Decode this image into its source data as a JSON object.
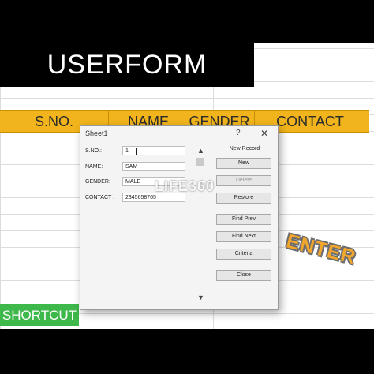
{
  "banner": {
    "title": "USERFORM"
  },
  "sheet": {
    "headers": [
      "S.NO.",
      "NAME",
      "GENDER",
      "CONTACT"
    ],
    "header_color": "#f1b41c",
    "shortcut_label": "SHORTCUT",
    "shortcut_color": "#3eb84a"
  },
  "dialog": {
    "title": "Sheet1",
    "help": "?",
    "close": "✕",
    "fields": [
      {
        "label": "S.NO.:",
        "value": "1"
      },
      {
        "label": "NAME:",
        "value": "SAM"
      },
      {
        "label": "GENDER:",
        "value": "MALE"
      },
      {
        "label": "CONTACT :",
        "value": "2345658765"
      }
    ],
    "record_label": "New Record",
    "buttons": {
      "new": "New",
      "delete": "Delete",
      "restore": "Restore",
      "find_prev": "Find Prev",
      "find_next": "Find Next",
      "criteria": "Criteria",
      "close": "Close"
    },
    "scroll_up": "▲",
    "scroll_down": "▼"
  },
  "overlays": {
    "watermark": "LIFE360",
    "sticker": "ENTER",
    "sticker_color": "#f3a62c"
  },
  "icons": [
    "text-cursor-icon",
    "scroll-up-icon",
    "scroll-down-icon",
    "close-icon",
    "help-icon"
  ]
}
